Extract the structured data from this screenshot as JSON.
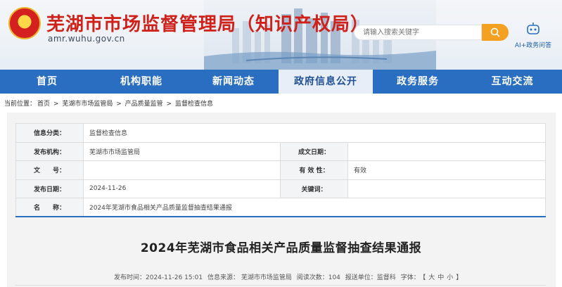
{
  "header": {
    "title": "芜湖市市场监督管理局（知识产权局）",
    "domain": "amr.wuhu.gov.cn",
    "search_placeholder": "请输入搜索关键字",
    "ai_label": "AI+政务问答"
  },
  "nav": {
    "items": [
      "首页",
      "机构职能",
      "新闻动态",
      "政府信息公开",
      "政务服务",
      "互动交流"
    ],
    "active_index": 3
  },
  "breadcrumb": {
    "prefix": "当前位置：",
    "items": [
      "首页",
      "芜湖市市场监管局",
      "产品质量监管",
      "监督检查信息"
    ],
    "separator": ">"
  },
  "info": {
    "category_label": "信息分类：",
    "category_value": "监督检查信息",
    "publisher_label": "发布机构：",
    "publisher_value": "芜湖市市场监管局",
    "created_label": "成文日期：",
    "created_value": "",
    "docno_label": "文　　号：",
    "docno_value": "",
    "validity_label": "有 效 性：",
    "validity_value": "有效",
    "pubdate_label": "发布日期：",
    "pubdate_value": "2024-11-26",
    "keywords_label": "关键词：",
    "keywords_value": "",
    "name_label": "名　　称：",
    "name_value": "2024年芜湖市食品相关产品质量监督抽查结果通报"
  },
  "article": {
    "title": "2024年芜湖市食品相关产品质量监督抽查结果通报",
    "publish_time": "发布时间：2024-11-26 15:01",
    "source": "信息来源：  芜湖市市场监管局",
    "reads": "阅读次数：104",
    "submitted_by": "报送单位：监督科",
    "font_size_label": "字体：",
    "font_size_open": "【",
    "font_large": "大",
    "font_medium": "中",
    "font_small": "小",
    "font_size_close": "】"
  },
  "colors": {
    "nav_bg": "#2a6ec1",
    "title_red": "#d0201a",
    "search_btn": "#f4a020"
  }
}
